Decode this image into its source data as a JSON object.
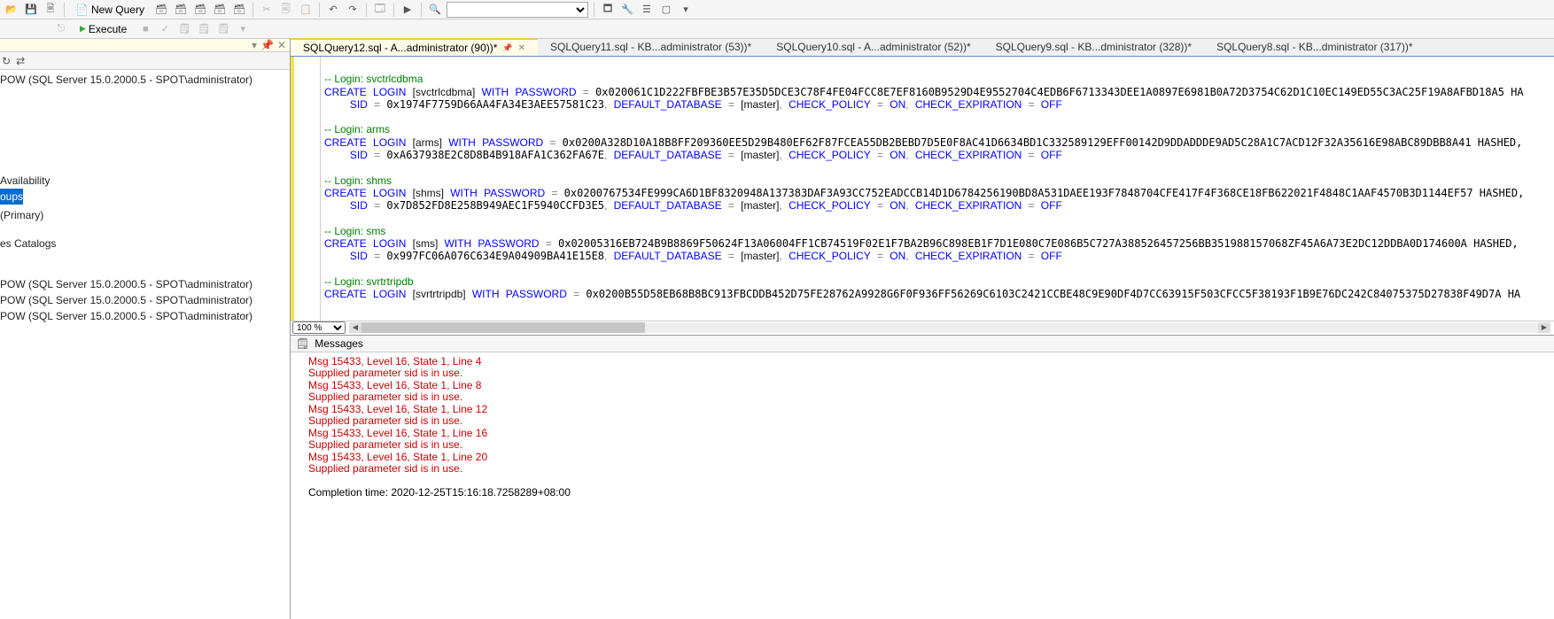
{
  "toolbar": {
    "new_query": "New Query",
    "db_dropdown_value": ""
  },
  "exec": {
    "execute": "Execute"
  },
  "sidebar": {
    "header_pin": "▾",
    "header_pin2": "📌",
    "header_close": "✕",
    "refresh": "↻",
    "sync": "⇄",
    "root": "POW (SQL Server 15.0.2000.5 - SPOT\\administrator)",
    "availability": "Availability",
    "groups": "oups",
    "primary": "(Primary)",
    "catalogs": "es Catalogs",
    "conn1": "POW (SQL Server 15.0.2000.5 - SPOT\\administrator)",
    "conn2": "POW (SQL Server 15.0.2000.5 - SPOT\\administrator)",
    "conn3": "POW (SQL Server 15.0.2000.5 - SPOT\\administrator)"
  },
  "tabs": [
    {
      "label": "SQLQuery12.sql - A...administrator (90))*",
      "active": true
    },
    {
      "label": "SQLQuery11.sql - KB...administrator (53))*",
      "active": false
    },
    {
      "label": "SQLQuery10.sql - A...administrator (52))*",
      "active": false
    },
    {
      "label": "SQLQuery9.sql - KB...dministrator (328))*",
      "active": false
    },
    {
      "label": "SQLQuery8.sql - KB...dministrator (317))*",
      "active": false
    }
  ],
  "code": {
    "logins": [
      {
        "name": "svctrlcdbma",
        "hash": "0x020061C1D222FBFBE3B57E35D5DCE3C78F4FE04FCC8E7EF8160B9529D4E9552704C4EDB6F6713343DEE1A0897E6981B0A72D3754C62D1C10EC149ED55C3AC25F19A8AFBD18A5",
        "end": "HA",
        "sid": "0x1974F7759D66AA4FA34E3AEE57581C23"
      },
      {
        "name": "arms",
        "hash": "0x0200A328D10A18B8FF209360EE5D29B480EF62F87FCEA55DB2BEBD7D5E0F8AC41D6634BD1C332589129EFF00142D9DDADDDE9AD5C28A1C7ACD12F32A35616E98ABC89DBB8A41",
        "end": "HASHED,",
        "sid": "0xA637938E2C8D8B4B918AFA1C362FA67E"
      },
      {
        "name": "shms",
        "hash": "0x0200767534FE999CA6D1BF8320948A137383DAF3A93CC752EADCCB14D1D6784256190BD8A531DAEE193F7848704CFE417F4F368CE18FB622021F4848C1AAF4570B3D1144EF57",
        "end": "HASHED,",
        "sid": "0x7D852FD8E258B949AEC1F5940CCFD3E5"
      },
      {
        "name": "sms",
        "hash": "0x02005316EB724B9B8869F50624F13A06004FF1CB74519F02E1F7BA2B96C898EB1F7D1E080C7E086B5C727A388526457256BB351988157068ZF45A6A73E2DC12DDBA0D174600A",
        "end": "HASHED,",
        "sid": "0x997FC06A076C634E9A04909BA41E15E8"
      },
      {
        "name": "svrtrtripdb",
        "hash": "0x0200B55D58EB68B8BC913FBCDDB452D75FE28762A9928G6F0F936FF56269C6103C2421CCBE48C9E90DF4D7CC63915F503CFCC5F38193F1B9E76DC242C84075375D27838F49D7A",
        "end": "HA",
        "sid": ""
      }
    ],
    "kw_create": "CREATE",
    "kw_login": "LOGIN",
    "kw_with": "WITH",
    "kw_password": "PASSWORD",
    "kw_sid": "SID",
    "kw_defdb": "DEFAULT_DATABASE",
    "kw_master": "[master]",
    "kw_chkpol": "CHECK_POLICY",
    "kw_on": "ON",
    "kw_chkexp": "CHECK_EXPIRATION",
    "kw_off": "OFF",
    "comment_prefix": "-- Login: "
  },
  "zoom": {
    "value": "100 %"
  },
  "messages": {
    "title": "Messages",
    "errors": [
      "Msg 15433, Level 16, State 1, Line 4",
      "Supplied parameter sid is in use.",
      "Msg 15433, Level 16, State 1, Line 8",
      "Supplied parameter sid is in use.",
      "Msg 15433, Level 16, State 1, Line 12",
      "Supplied parameter sid is in use.",
      "Msg 15433, Level 16, State 1, Line 16",
      "Supplied parameter sid is in use.",
      "Msg 15433, Level 16, State 1, Line 20",
      "Supplied parameter sid is in use."
    ],
    "completion": "Completion time: 2020-12-25T15:16:18.7258289+08:00"
  }
}
